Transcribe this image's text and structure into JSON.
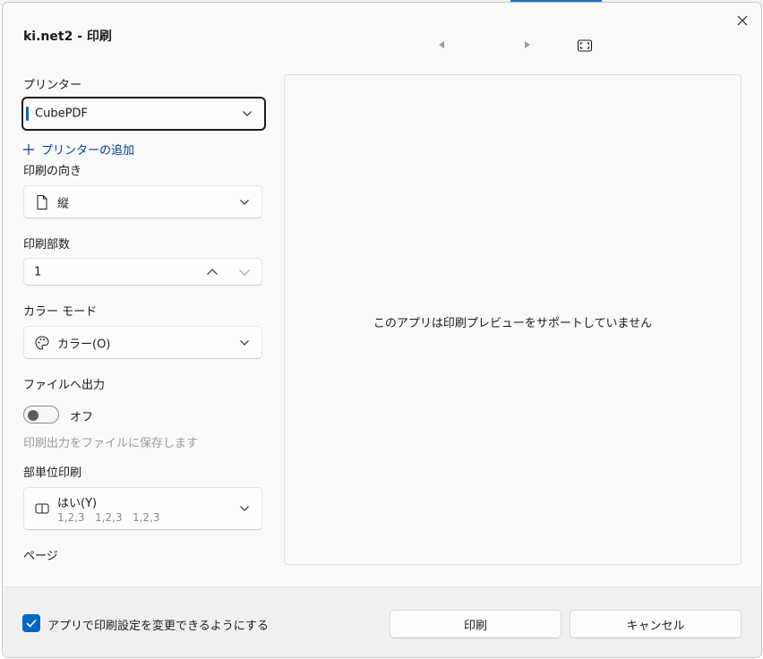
{
  "colors": {
    "accent": "#0067c0",
    "link": "#003e92",
    "hint": "#9a9a9a"
  },
  "dialog": {
    "title": "ki.net2 - 印刷"
  },
  "icons": {
    "close": "close-icon",
    "prev": "caret-left-icon",
    "next": "caret-right-icon",
    "fit": "fit-page-icon"
  },
  "printer": {
    "label": "プリンター",
    "value": "CubePDF",
    "add_label": "プリンターの追加"
  },
  "orientation": {
    "label": "印刷の向き",
    "value": "縦"
  },
  "copies": {
    "label": "印刷部数",
    "value": "1"
  },
  "color_mode": {
    "label": "カラー モード",
    "value": "カラー(O)"
  },
  "print_to_file": {
    "label": "ファイルへ出力",
    "state": "オフ",
    "hint": "印刷出力をファイルに保存します"
  },
  "collate": {
    "label": "部単位印刷",
    "value": "はい(Y)",
    "detail": "1,2,3   1,2,3   1,2,3"
  },
  "pages": {
    "label": "ページ"
  },
  "preview": {
    "message": "このアプリは印刷プレビューをサポートしていません"
  },
  "footer": {
    "checkbox_label": "アプリで印刷設定を変更できるようにする",
    "checked": true,
    "print_button": "印刷",
    "cancel_button": "キャンセル"
  }
}
